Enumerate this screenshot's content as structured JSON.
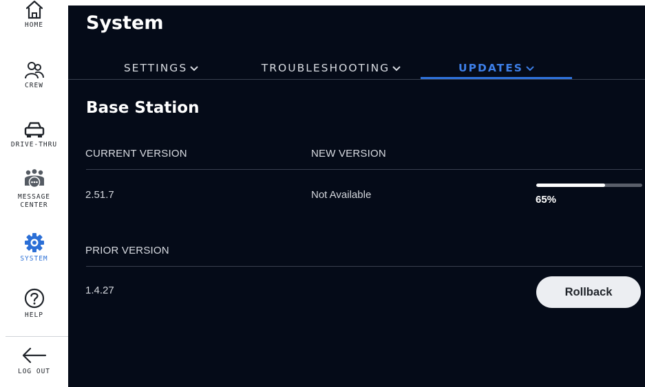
{
  "colors": {
    "sidebar_bg": "#ffffff",
    "main_bg": "#050b18",
    "accent": "#2f74e0",
    "text_primary": "#ffffff",
    "text_secondary": "#d4d7dd"
  },
  "sidebar": {
    "items": [
      {
        "icon": "home-icon",
        "label": "HOME"
      },
      {
        "icon": "crew-icon",
        "label": "CREW"
      },
      {
        "icon": "car-icon",
        "label": "DRIVE-THRU"
      },
      {
        "icon": "message-center-icon",
        "label_line1": "MESSAGE",
        "label_line2": "CENTER"
      },
      {
        "icon": "gear-icon",
        "label": "SYSTEM",
        "active": true
      },
      {
        "icon": "help-icon",
        "label": "HELP"
      },
      {
        "icon": "arrow-left-icon",
        "label": "LOG OUT"
      }
    ]
  },
  "header": {
    "title": "System"
  },
  "tabs": [
    {
      "label": "SETTINGS"
    },
    {
      "label": "TROUBLESHOOTING"
    },
    {
      "label": "UPDATES",
      "active": true
    }
  ],
  "section": {
    "title": "Base Station",
    "current_version_label": "CURRENT VERSION",
    "new_version_label": "NEW VERSION",
    "current_version": "2.51.7",
    "new_version": "Not Available",
    "progress_fraction": 0.65,
    "progress_text": "65%",
    "prior_version_label": "PRIOR VERSION",
    "prior_version": "1.4.27",
    "rollback_label": "Rollback"
  }
}
